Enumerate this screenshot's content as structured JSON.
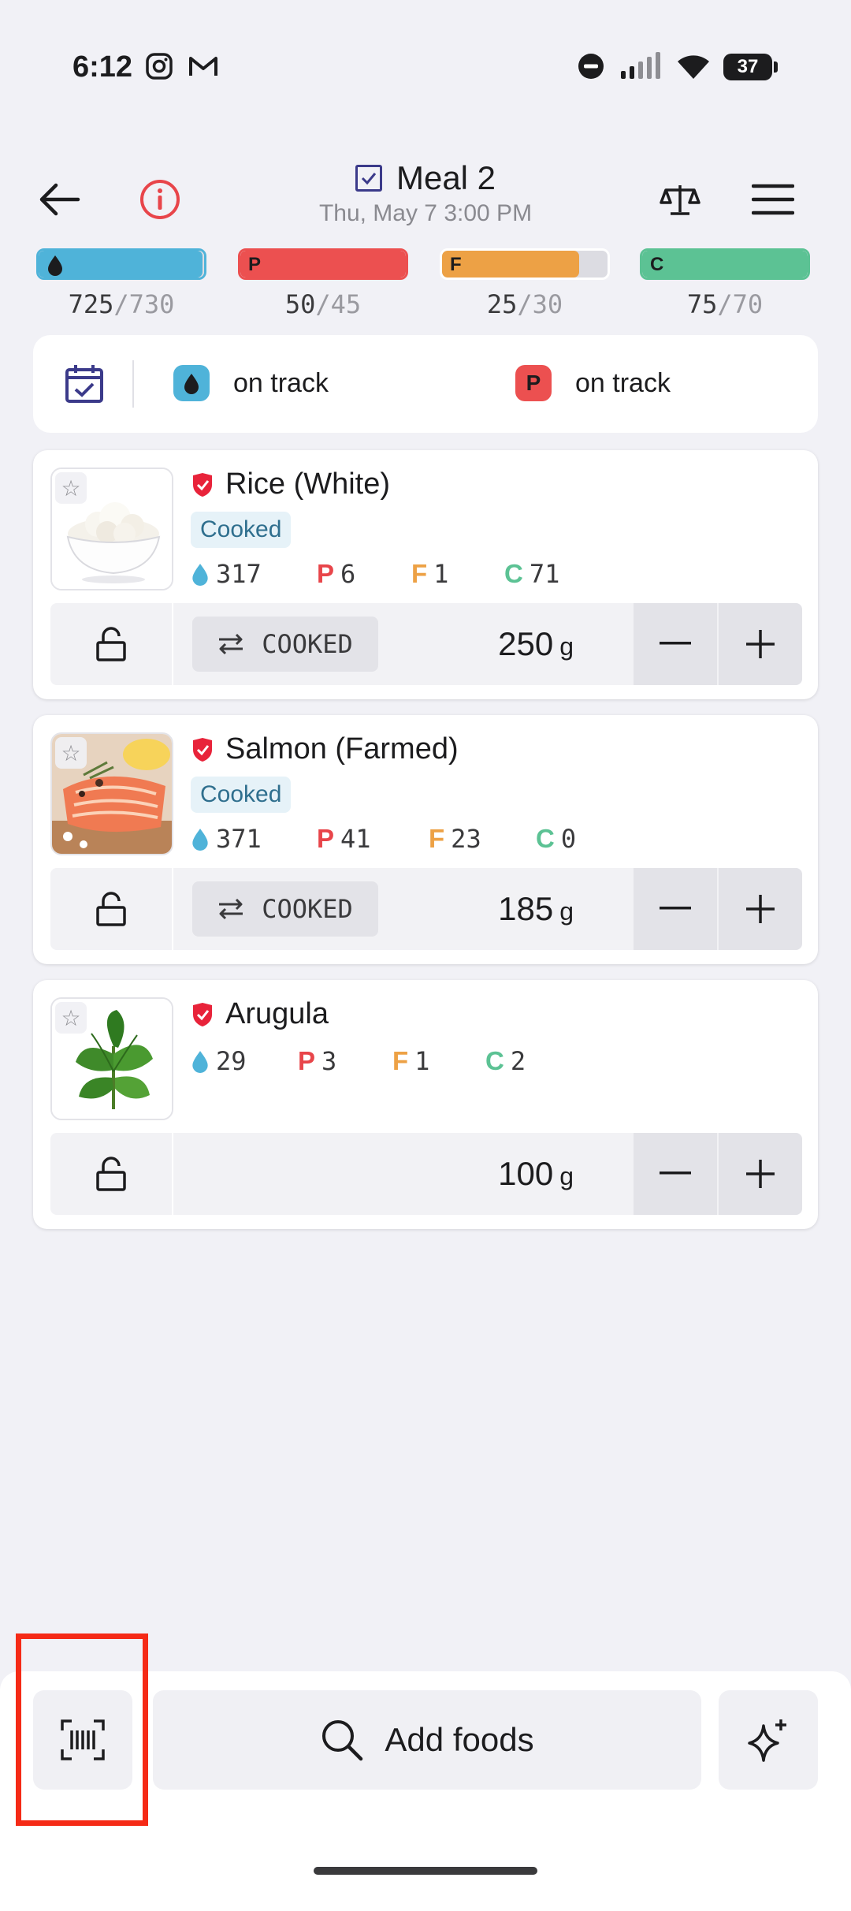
{
  "status_bar": {
    "time": "6:12",
    "battery": "37"
  },
  "header": {
    "title": "Meal 2",
    "date": "Thu, May 7 3:00 PM"
  },
  "macros": [
    {
      "letter": "",
      "current": "725",
      "goal": "/730",
      "fraction": 0.99,
      "color": "#4fb3d9",
      "border": "#4fb3d9"
    },
    {
      "letter": "P",
      "current": "50",
      "goal": "/45",
      "fraction": 1.0,
      "color": "#ec5050",
      "border": "#ec5050"
    },
    {
      "letter": "F",
      "current": "25",
      "goal": "/30",
      "fraction": 0.83,
      "color": "#eda145",
      "border": "#ffffff"
    },
    {
      "letter": "C",
      "current": "75",
      "goal": "/70",
      "fraction": 1.0,
      "color": "#5cc294",
      "border": "#5cc294"
    }
  ],
  "tracking": {
    "energy_status": "on track",
    "protein_letter": "P",
    "protein_status": "on track"
  },
  "foods": [
    {
      "name": "Rice (White)",
      "tag": "Cooked",
      "energy": "317",
      "p_label": "P",
      "protein": "6",
      "f_label": "F",
      "fat": "1",
      "c_label": "C",
      "carbs": "71",
      "form": "COOKED",
      "quantity": "250",
      "unit": "g"
    },
    {
      "name": "Salmon (Farmed)",
      "tag": "Cooked",
      "energy": "371",
      "p_label": "P",
      "protein": "41",
      "f_label": "F",
      "fat": "23",
      "c_label": "C",
      "carbs": "0",
      "form": "COOKED",
      "quantity": "185",
      "unit": "g"
    },
    {
      "name": "Arugula",
      "energy": "29",
      "p_label": "P",
      "protein": "3",
      "f_label": "F",
      "fat": "1",
      "c_label": "C",
      "carbs": "2",
      "quantity": "100",
      "unit": "g"
    }
  ],
  "bottom": {
    "add_label": "Add foods"
  },
  "icons": {
    "back": "arrow-left-icon",
    "info": "info-icon",
    "scale": "scale-icon",
    "menu": "hamburger-menu-icon",
    "calendar": "calendar-check-icon",
    "energy": "flame-drop-icon",
    "star": "star-icon",
    "verified": "red-shield-check-icon",
    "lock": "unlock-icon",
    "swap": "swap-arrows-icon",
    "minus": "minus-icon",
    "plus": "plus-icon",
    "barcode": "barcode-scan-icon",
    "search": "search-icon",
    "sparkle": "ai-sparkle-icon"
  },
  "colors": {
    "energy": "#4fb3d9",
    "protein": "#e8454a",
    "fat": "#eda145",
    "carbs": "#5cc294",
    "highlight": "#f52a16"
  }
}
